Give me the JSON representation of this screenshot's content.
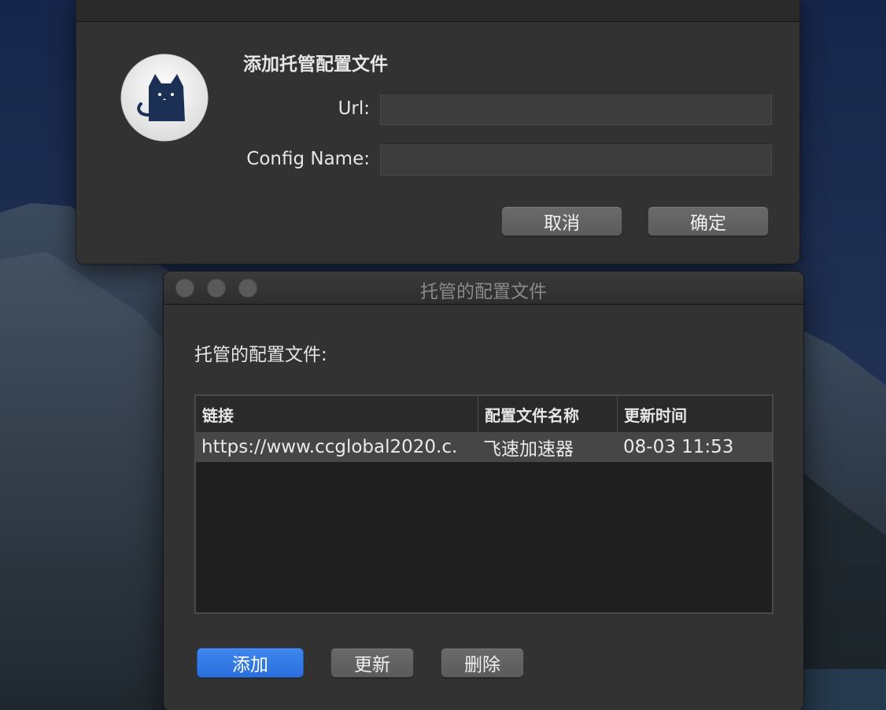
{
  "sheet": {
    "title": "添加托管配置文件",
    "url_label": "Url:",
    "url_value": "",
    "name_label": "Config Name:",
    "name_value": "",
    "cancel_label": "取消",
    "ok_label": "确定",
    "app_icon": "cat-icon"
  },
  "window": {
    "title": "托管的配置文件",
    "section_label": "托管的配置文件:",
    "columns": [
      "链接",
      "配置文件名称",
      "更新时间"
    ],
    "rows": [
      {
        "link": "https://www.ccglobal2020.c.",
        "name": "飞速加速器",
        "updated": "08-03 11:53"
      }
    ],
    "buttons": {
      "add": "添加",
      "update": "更新",
      "delete": "删除"
    }
  },
  "colors": {
    "accent": "#2f78e6",
    "window_bg": "#323232",
    "row_selected": "#464646"
  }
}
